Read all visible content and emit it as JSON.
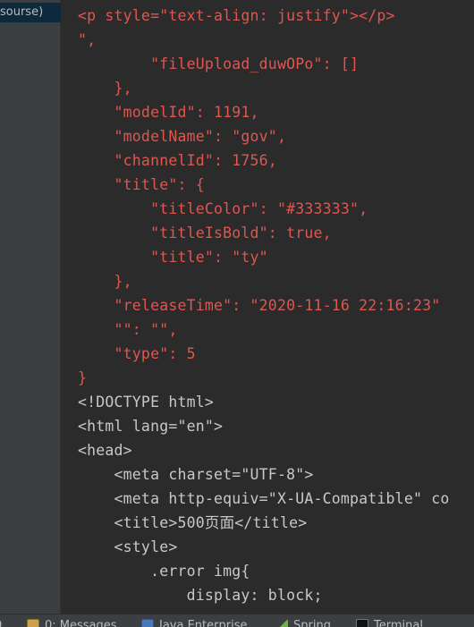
{
  "project_tree": {
    "selected_item": "sourse)"
  },
  "editor": {
    "lines": [
      [
        {
          "t": "<p style=\"text-align: justify\"></p>",
          "c": "red"
        }
      ],
      [
        {
          "t": "\",",
          "c": "red"
        }
      ],
      [
        {
          "t": "        \"fileUpload_duwOPo\": []",
          "c": "red"
        }
      ],
      [
        {
          "t": "    },",
          "c": "red"
        }
      ],
      [
        {
          "t": "    \"modelId\": 1191,",
          "c": "red"
        }
      ],
      [
        {
          "t": "    \"modelName\": \"gov\",",
          "c": "red"
        }
      ],
      [
        {
          "t": "    \"channelId\": 1756,",
          "c": "red"
        }
      ],
      [
        {
          "t": "    \"title\": {",
          "c": "red"
        }
      ],
      [
        {
          "t": "        \"titleColor\": \"#333333\",",
          "c": "red"
        }
      ],
      [
        {
          "t": "        \"titleIsBold\": true,",
          "c": "red"
        }
      ],
      [
        {
          "t": "        \"title\": \"ty\"",
          "c": "red"
        }
      ],
      [
        {
          "t": "    },",
          "c": "red"
        }
      ],
      [
        {
          "t": "    \"releaseTime\": \"2020-11-16 22:16:23\"",
          "c": "red"
        }
      ],
      [
        {
          "t": "    \"\": \"\",",
          "c": "red"
        }
      ],
      [
        {
          "t": "    \"type\": 5",
          "c": "red"
        }
      ],
      [
        {
          "t": "}",
          "c": "red"
        }
      ],
      [
        {
          "t": "<!DOCTYPE html>",
          "c": "plain"
        }
      ],
      [
        {
          "t": "<html lang=\"en\">",
          "c": "plain"
        }
      ],
      [
        {
          "t": "<head>",
          "c": "plain"
        }
      ],
      [
        {
          "t": "    <meta charset=\"UTF-8\">",
          "c": "plain"
        }
      ],
      [
        {
          "t": "    <meta http-equiv=\"X-UA-Compatible\" co",
          "c": "plain"
        }
      ],
      [
        {
          "t": "    <title>500页面</title>",
          "c": "plain"
        }
      ],
      [
        {
          "t": "    <style>",
          "c": "plain"
        }
      ],
      [
        {
          "t": "        .error img{",
          "c": "plain"
        }
      ],
      [
        {
          "t": "            display: block;",
          "c": "plain"
        }
      ],
      [
        {
          "t": "            ",
          "c": "plain"
        }
      ]
    ]
  },
  "bottom_toolbar": {
    "tabs": [
      {
        "name": "tool-tab-left-edge",
        "label": "0",
        "icon": ""
      },
      {
        "name": "tool-tab-messages",
        "label": "0: Messages",
        "icon": "messages-icon"
      },
      {
        "name": "tool-tab-java-enterprise",
        "label": "Java Enterprise",
        "icon": "java-enterprise-icon"
      },
      {
        "name": "tool-tab-spring",
        "label": "Spring",
        "icon": "spring-icon"
      },
      {
        "name": "tool-tab-terminal",
        "label": "Terminal",
        "icon": "terminal-icon"
      }
    ]
  },
  "colors": {
    "editor_background": "#2b2b2b",
    "panel_background": "#3c3f41",
    "selection_background": "#0d293e",
    "red_text": "#e0564f",
    "plain_text": "#c8c8c8"
  }
}
